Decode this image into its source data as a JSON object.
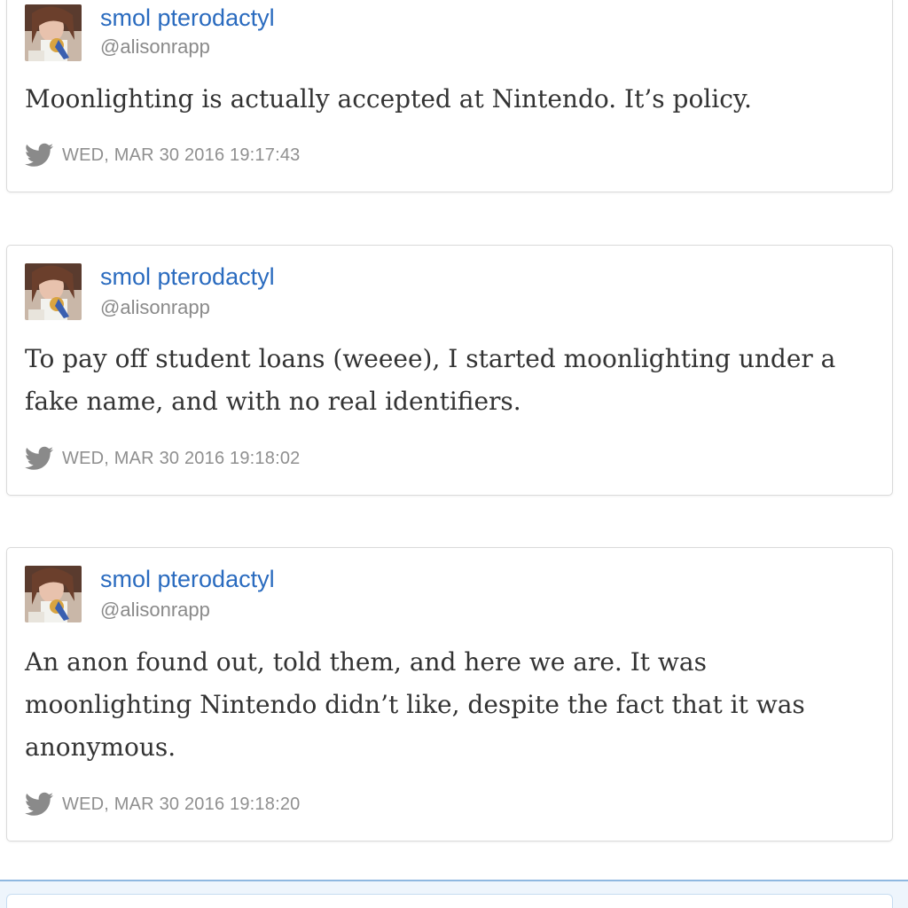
{
  "tweets": [
    {
      "author_name": "smol pterodactyl",
      "handle": "@alisonrapp",
      "text": "Moonlighting is actually accepted at Nintendo. It’s policy.",
      "timestamp": "WED, MAR 30 2016 19:17:43",
      "source_icon": "twitter-bird-icon"
    },
    {
      "author_name": "smol pterodactyl",
      "handle": "@alisonrapp",
      "text": "To pay off student loans (weeee), I started moonlighting under a fake name, and with no real identifiers.",
      "timestamp": "WED, MAR 30 2016 19:18:02",
      "source_icon": "twitter-bird-icon"
    },
    {
      "author_name": "smol pterodactyl",
      "handle": "@alisonrapp",
      "text": "An anon found out, told them, and here we are. It was moonlighting Nintendo didn’t like, despite the fact that it was anonymous.",
      "timestamp": "WED, MAR 30 2016 19:18:20",
      "source_icon": "twitter-bird-icon"
    }
  ],
  "colors": {
    "author_name": "#2a6bbf",
    "handle": "#8a8a8a",
    "timestamp": "#8f8f8f",
    "body_text": "#333333",
    "card_border": "#dadada"
  }
}
